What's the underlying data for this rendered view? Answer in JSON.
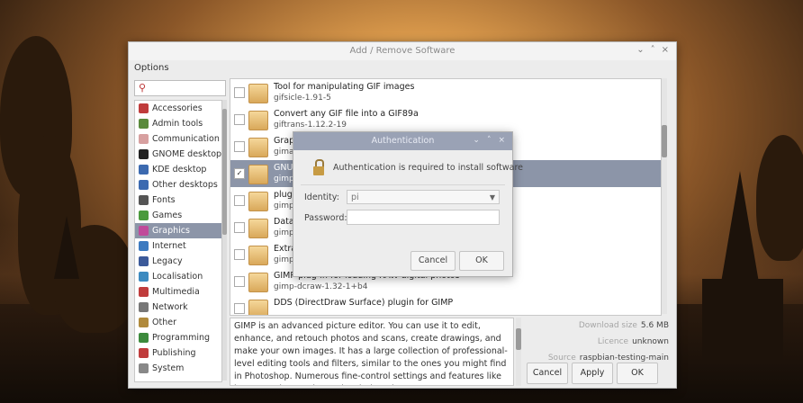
{
  "window": {
    "title": "Add / Remove Software",
    "controls": [
      "⌄",
      "˄",
      "×"
    ],
    "menu": "Options"
  },
  "search": {
    "icon": "search-icon",
    "value": ""
  },
  "categories": [
    {
      "label": "Accessories",
      "color": "#c03c3c"
    },
    {
      "label": "Admin tools",
      "color": "#5a8a3c"
    },
    {
      "label": "Communication",
      "color": "#d7a0a0"
    },
    {
      "label": "GNOME desktop",
      "color": "#222222"
    },
    {
      "label": "KDE desktop",
      "color": "#3c6ab0"
    },
    {
      "label": "Other desktops",
      "color": "#3c6ab0"
    },
    {
      "label": "Fonts",
      "color": "#555555"
    },
    {
      "label": "Games",
      "color": "#4a9a3c"
    },
    {
      "label": "Graphics",
      "color": "#c04a9a"
    },
    {
      "label": "Internet",
      "color": "#3c7ac0"
    },
    {
      "label": "Legacy",
      "color": "#3c5a9a"
    },
    {
      "label": "Localisation",
      "color": "#3c8ac0"
    },
    {
      "label": "Multimedia",
      "color": "#c03c3c"
    },
    {
      "label": "Network",
      "color": "#777777"
    },
    {
      "label": "Other",
      "color": "#b08a3c"
    },
    {
      "label": "Programming",
      "color": "#3c8a3c"
    },
    {
      "label": "Publishing",
      "color": "#c03c3c"
    },
    {
      "label": "System",
      "color": "#888888"
    }
  ],
  "selected_category": "Graphics",
  "packages": [
    {
      "title": "Tool for manipulating GIF images",
      "name": "gifsicle-1.91-5",
      "checked": false,
      "selected": false
    },
    {
      "title": "Convert any GIF file into a GIF89a",
      "name": "giftrans-1.12.2-19",
      "checked": false,
      "selected": false
    },
    {
      "title": "Graph",
      "name": "gima",
      "checked": false,
      "selected": false
    },
    {
      "title": "GNU",
      "name": "gimp",
      "checked": true,
      "selected": true
    },
    {
      "title": "plugi",
      "name": "gimp",
      "checked": false,
      "selected": false
    },
    {
      "title": "Data",
      "name": "gimp",
      "checked": false,
      "selected": false
    },
    {
      "title": "Extra",
      "name": "gimp",
      "checked": false,
      "selected": false
    },
    {
      "title": "GIMP plug-in for loading RAW digital photos",
      "name": "gimp-dcraw-1.32-1+b4",
      "checked": false,
      "selected": false
    },
    {
      "title": "DDS (DirectDraw Surface) plugin for GIMP",
      "name": "",
      "checked": false,
      "selected": false
    }
  ],
  "description": "GIMP is an advanced picture editor. You can use it to edit, enhance, and retouch photos and scans, create drawings, and make your own images. It has a large collection of professional-level editing tools and filters, similar to the ones you might find in Photoshop. Numerous fine-control settings and features like layers, paths, masks, and scripting give you",
  "info": {
    "download_label": "Download size",
    "download_value": "5.6 MB",
    "licence_label": "Licence",
    "licence_value": "unknown",
    "source_label": "Source",
    "source_value": "raspbian-testing-main"
  },
  "buttons": {
    "cancel": "Cancel",
    "apply": "Apply",
    "ok": "OK"
  },
  "auth": {
    "title": "Authentication",
    "controls": [
      "⌄",
      "˄",
      "×"
    ],
    "message": "Authentication is required to install software",
    "identity_label": "Identity:",
    "identity_value": "pi",
    "password_label": "Password:",
    "password_value": "",
    "cancel": "Cancel",
    "ok": "OK"
  },
  "colors": {
    "selection": "#8c95a8",
    "dialog_titlebar": "#9aa2b5"
  }
}
